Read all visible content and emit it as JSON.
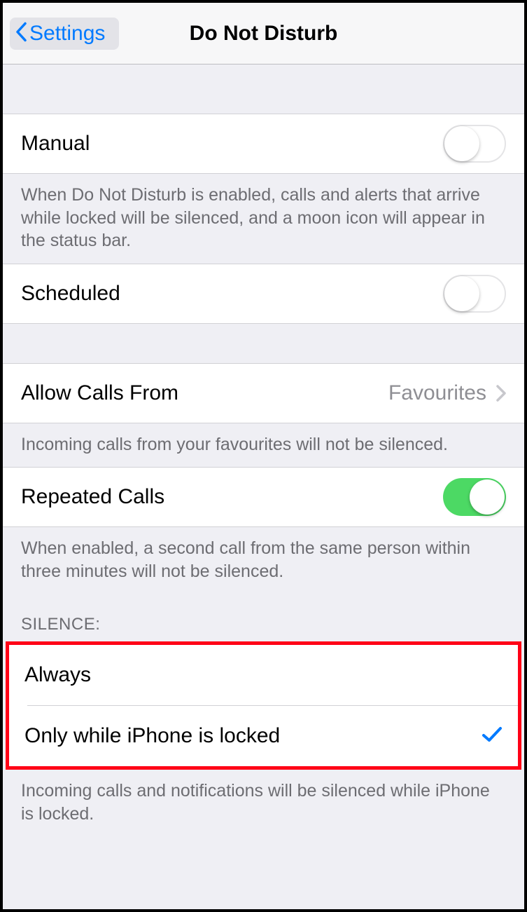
{
  "nav": {
    "back_label": "Settings",
    "title": "Do Not Disturb"
  },
  "sections": {
    "manual": {
      "label": "Manual",
      "footer": "When Do Not Disturb is enabled, calls and alerts that arrive while locked will be silenced, and a moon icon will appear in the status bar."
    },
    "scheduled": {
      "label": "Scheduled"
    },
    "allow_calls": {
      "label": "Allow Calls From",
      "value": "Favourites",
      "footer": "Incoming calls from your favourites will not be silenced."
    },
    "repeated": {
      "label": "Repeated Calls",
      "footer": "When enabled, a second call from the same person within three minutes will not be silenced."
    },
    "silence": {
      "header": "SILENCE:",
      "option_always": "Always",
      "option_locked": "Only while iPhone is locked",
      "footer": "Incoming calls and notifications will be silenced while iPhone is locked."
    }
  }
}
